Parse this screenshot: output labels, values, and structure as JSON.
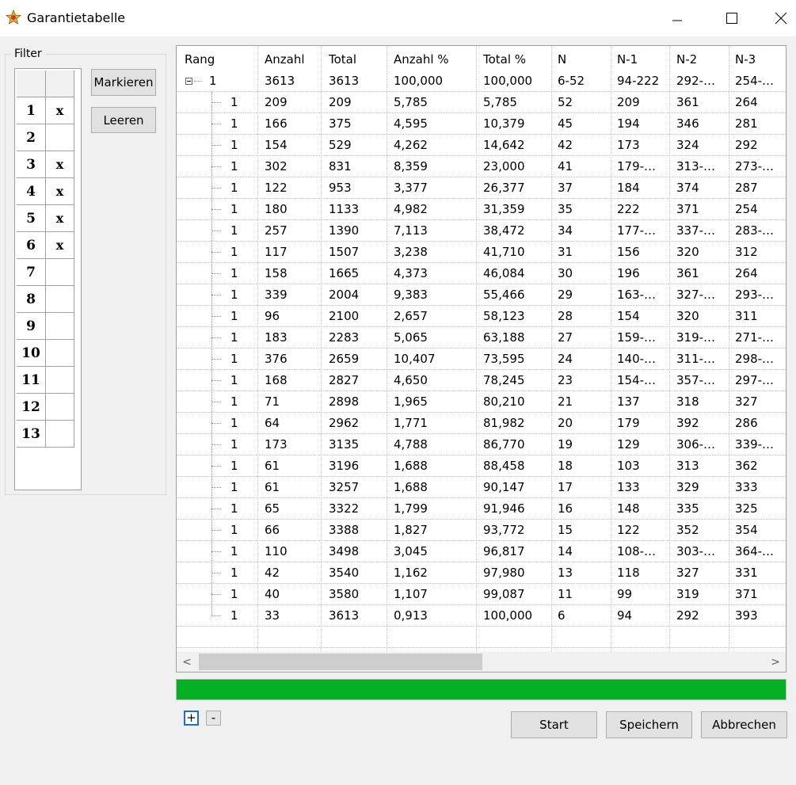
{
  "window": {
    "title": "Garantietabelle"
  },
  "filter": {
    "legend": "Filter",
    "rows": [
      {
        "num": "1",
        "mark": "x"
      },
      {
        "num": "2",
        "mark": ""
      },
      {
        "num": "3",
        "mark": "x"
      },
      {
        "num": "4",
        "mark": "x"
      },
      {
        "num": "5",
        "mark": "x"
      },
      {
        "num": "6",
        "mark": "x"
      },
      {
        "num": "7",
        "mark": ""
      },
      {
        "num": "8",
        "mark": ""
      },
      {
        "num": "9",
        "mark": ""
      },
      {
        "num": "10",
        "mark": ""
      },
      {
        "num": "11",
        "mark": ""
      },
      {
        "num": "12",
        "mark": ""
      },
      {
        "num": "13",
        "mark": ""
      }
    ],
    "markieren_label": "Markieren",
    "leeren_label": "Leeren"
  },
  "tree": {
    "columns": [
      "Rang",
      "Anzahl",
      "Total",
      "Anzahl %",
      "Total %",
      "N",
      "N-1",
      "N-2",
      "N-3"
    ],
    "root": [
      "1",
      "3613",
      "3613",
      "100,000",
      "100,000",
      "6-52",
      "94-222",
      "292-…",
      "254-…"
    ],
    "children": [
      [
        "1",
        "209",
        "209",
        "5,785",
        "5,785",
        "52",
        "209",
        "361",
        "264"
      ],
      [
        "1",
        "166",
        "375",
        "4,595",
        "10,379",
        "45",
        "194",
        "346",
        "281"
      ],
      [
        "1",
        "154",
        "529",
        "4,262",
        "14,642",
        "42",
        "173",
        "324",
        "292"
      ],
      [
        "1",
        "302",
        "831",
        "8,359",
        "23,000",
        "41",
        "179-…",
        "313-…",
        "273-…"
      ],
      [
        "1",
        "122",
        "953",
        "3,377",
        "26,377",
        "37",
        "184",
        "374",
        "287"
      ],
      [
        "1",
        "180",
        "1133",
        "4,982",
        "31,359",
        "35",
        "222",
        "371",
        "254"
      ],
      [
        "1",
        "257",
        "1390",
        "7,113",
        "38,472",
        "34",
        "177-…",
        "337-…",
        "283-…"
      ],
      [
        "1",
        "117",
        "1507",
        "3,238",
        "41,710",
        "31",
        "156",
        "320",
        "312"
      ],
      [
        "1",
        "158",
        "1665",
        "4,373",
        "46,084",
        "30",
        "196",
        "361",
        "264"
      ],
      [
        "1",
        "339",
        "2004",
        "9,383",
        "55,466",
        "29",
        "163-…",
        "327-…",
        "293-…"
      ],
      [
        "1",
        "96",
        "2100",
        "2,657",
        "58,123",
        "28",
        "154",
        "320",
        "311"
      ],
      [
        "1",
        "183",
        "2283",
        "5,065",
        "63,188",
        "27",
        "159-…",
        "319-…",
        "271-…"
      ],
      [
        "1",
        "376",
        "2659",
        "10,407",
        "73,595",
        "24",
        "140-…",
        "311-…",
        "298-…"
      ],
      [
        "1",
        "168",
        "2827",
        "4,650",
        "78,245",
        "23",
        "154-…",
        "357-…",
        "297-…"
      ],
      [
        "1",
        "71",
        "2898",
        "1,965",
        "80,210",
        "21",
        "137",
        "318",
        "327"
      ],
      [
        "1",
        "64",
        "2962",
        "1,771",
        "81,982",
        "20",
        "179",
        "392",
        "286"
      ],
      [
        "1",
        "173",
        "3135",
        "4,788",
        "86,770",
        "19",
        "129",
        "306-…",
        "339-…"
      ],
      [
        "1",
        "61",
        "3196",
        "1,688",
        "88,458",
        "18",
        "103",
        "313",
        "362"
      ],
      [
        "1",
        "61",
        "3257",
        "1,688",
        "90,147",
        "17",
        "133",
        "329",
        "333"
      ],
      [
        "1",
        "65",
        "3322",
        "1,799",
        "91,946",
        "16",
        "148",
        "335",
        "325"
      ],
      [
        "1",
        "66",
        "3388",
        "1,827",
        "93,772",
        "15",
        "122",
        "352",
        "354"
      ],
      [
        "1",
        "110",
        "3498",
        "3,045",
        "96,817",
        "14",
        "108-…",
        "303-…",
        "364-…"
      ],
      [
        "1",
        "42",
        "3540",
        "1,162",
        "97,980",
        "13",
        "118",
        "327",
        "331"
      ],
      [
        "1",
        "40",
        "3580",
        "1,107",
        "99,087",
        "11",
        "99",
        "319",
        "371"
      ],
      [
        "1",
        "33",
        "3613",
        "0,913",
        "100,000",
        "6",
        "94",
        "292",
        "393"
      ]
    ]
  },
  "scroll": {
    "left_arrow": "<",
    "right_arrow": ">"
  },
  "progress": {
    "fraction": 1.0,
    "color": "#06b025"
  },
  "tree_buttons": {
    "plus": "+",
    "minus": "-"
  },
  "actions": {
    "start_label": "Start",
    "save_label": "Speichern",
    "cancel_label": "Abbrechen"
  }
}
